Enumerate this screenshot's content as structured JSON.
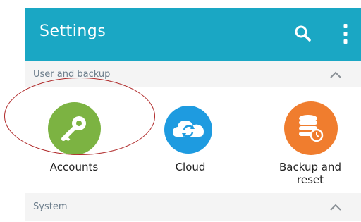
{
  "appbar": {
    "title": "Settings",
    "search_icon": "search-icon",
    "more_icon": "more-vert-icon",
    "color": "#1aa7c4"
  },
  "sections": [
    {
      "title": "User and backup",
      "collapse_icon": "chevron-up-icon",
      "items": [
        {
          "label": "Accounts",
          "icon": "key-icon",
          "color": "#7cb342"
        },
        {
          "label": "Cloud",
          "icon": "cloud-sync-icon",
          "color": "#1e9be0"
        },
        {
          "label": "Backup and reset",
          "icon": "backup-database-icon",
          "color": "#f07d2e"
        }
      ]
    },
    {
      "title": "System",
      "collapse_icon": "chevron-up-icon"
    }
  ],
  "annotation_color": "#b02a2a"
}
